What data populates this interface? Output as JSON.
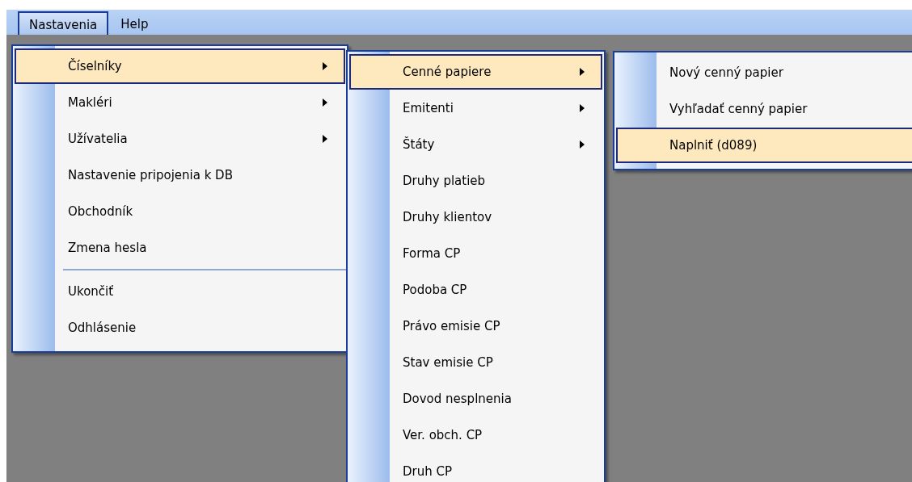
{
  "menubar": [
    {
      "label": "Nastavenia",
      "selected": true
    },
    {
      "label": "Help",
      "selected": false
    }
  ],
  "menus": [
    {
      "items": [
        {
          "kind": "item",
          "label": "Číselníky",
          "submenu": true,
          "selected": true
        },
        {
          "kind": "item",
          "label": "Makléri",
          "submenu": true,
          "selected": false
        },
        {
          "kind": "item",
          "label": "Užívatelia",
          "submenu": true,
          "selected": false
        },
        {
          "kind": "item",
          "label": "Nastavenie pripojenia k DB",
          "submenu": false,
          "selected": false
        },
        {
          "kind": "item",
          "label": "Obchodník",
          "submenu": false,
          "selected": false
        },
        {
          "kind": "item",
          "label": "Zmena hesla",
          "submenu": false,
          "selected": false
        },
        {
          "kind": "separator"
        },
        {
          "kind": "item",
          "label": "Ukončiť",
          "submenu": false,
          "selected": false
        },
        {
          "kind": "item",
          "label": "Odhlásenie",
          "submenu": false,
          "selected": false
        }
      ]
    },
    {
      "items": [
        {
          "kind": "item",
          "label": "Cenné papiere",
          "submenu": true,
          "selected": true
        },
        {
          "kind": "item",
          "label": "Emitenti",
          "submenu": true,
          "selected": false
        },
        {
          "kind": "item",
          "label": "Štáty",
          "submenu": true,
          "selected": false
        },
        {
          "kind": "item",
          "label": "Druhy platieb",
          "submenu": false,
          "selected": false
        },
        {
          "kind": "item",
          "label": "Druhy klientov",
          "submenu": false,
          "selected": false
        },
        {
          "kind": "item",
          "label": "Forma CP",
          "submenu": false,
          "selected": false
        },
        {
          "kind": "item",
          "label": "Podoba CP",
          "submenu": false,
          "selected": false
        },
        {
          "kind": "item",
          "label": "Právo emisie CP",
          "submenu": false,
          "selected": false
        },
        {
          "kind": "item",
          "label": "Stav emisie CP",
          "submenu": false,
          "selected": false
        },
        {
          "kind": "item",
          "label": "Dovod nesplnenia",
          "submenu": false,
          "selected": false
        },
        {
          "kind": "item",
          "label": "Ver. obch. CP",
          "submenu": false,
          "selected": false
        },
        {
          "kind": "item",
          "label": "Druh CP",
          "submenu": false,
          "selected": false
        }
      ]
    },
    {
      "items": [
        {
          "kind": "item",
          "label": "Nový cenný papier",
          "submenu": false,
          "selected": false
        },
        {
          "kind": "item",
          "label": "Vyhľadať cenný papier",
          "submenu": false,
          "selected": false
        },
        {
          "kind": "item",
          "label": "Naplniť (d089)",
          "submenu": false,
          "selected": true
        }
      ]
    }
  ]
}
